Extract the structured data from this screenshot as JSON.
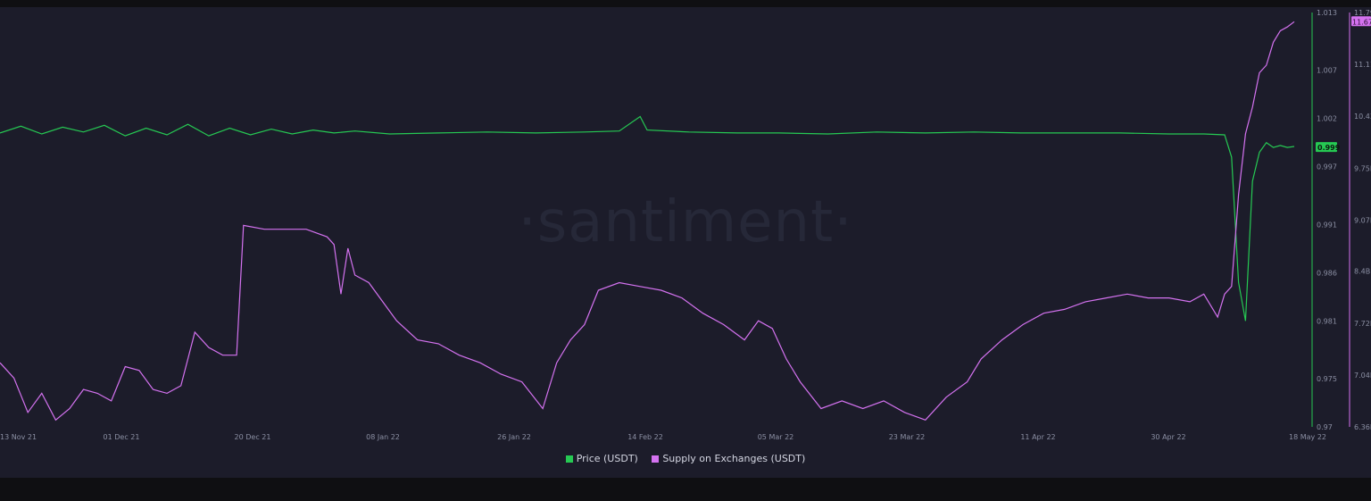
{
  "watermark": "·santiment·",
  "colors": {
    "background": "#1c1c2a",
    "price": "#26c953",
    "supply": "#d472f0",
    "text": "#8b8fa3"
  },
  "chart_data": {
    "type": "line",
    "x_ticks": [
      "13 Nov 21",
      "01 Dec 21",
      "20 Dec 21",
      "08 Jan 22",
      "26 Jan 22",
      "14 Feb 22",
      "05 Mar 22",
      "23 Mar 22",
      "11 Apr 22",
      "30 Apr 22",
      "18 May 22"
    ],
    "x_range": [
      "2021-11-13",
      "2022-05-18"
    ],
    "y_left": {
      "ticks": [
        "1.013",
        "1.007",
        "1.002",
        "0.997",
        "0.991",
        "0.986",
        "0.981",
        "0.975",
        "0.97"
      ],
      "range": [
        0.97,
        1.013
      ]
    },
    "y_right": {
      "ticks": [
        "11.79B",
        "11.11B",
        "10.43B",
        "9.75B",
        "9.07B",
        "8.4B",
        "7.72B",
        "7.04B",
        "6.36B"
      ],
      "range": [
        6.36,
        11.79
      ]
    },
    "current_labels": {
      "price": "0.999",
      "supply": "11.67B"
    },
    "legend": [
      {
        "name": "Price (USDT)",
        "color": "#26c953"
      },
      {
        "name": "Supply on Exchanges (USDT)",
        "color": "#d472f0"
      }
    ],
    "series": [
      {
        "name": "Price (USDT)",
        "axis": "left",
        "points": [
          [
            "2021-11-13",
            1.0005
          ],
          [
            "2021-11-16",
            1.0012
          ],
          [
            "2021-11-19",
            1.0004
          ],
          [
            "2021-11-22",
            1.0011
          ],
          [
            "2021-11-25",
            1.0006
          ],
          [
            "2021-11-28",
            1.0013
          ],
          [
            "2021-12-01",
            1.0002
          ],
          [
            "2021-12-04",
            1.001
          ],
          [
            "2021-12-07",
            1.0003
          ],
          [
            "2021-12-10",
            1.0014
          ],
          [
            "2021-12-13",
            1.0002
          ],
          [
            "2021-12-16",
            1.001
          ],
          [
            "2021-12-19",
            1.0003
          ],
          [
            "2021-12-22",
            1.0009
          ],
          [
            "2021-12-25",
            1.0004
          ],
          [
            "2021-12-28",
            1.0008
          ],
          [
            "2021-12-31",
            1.0005
          ],
          [
            "2022-01-03",
            1.0007
          ],
          [
            "2022-01-08",
            1.0004
          ],
          [
            "2022-01-15",
            1.0005
          ],
          [
            "2022-01-22",
            1.0006
          ],
          [
            "2022-01-29",
            1.0005
          ],
          [
            "2022-02-05",
            1.0006
          ],
          [
            "2022-02-10",
            1.0007
          ],
          [
            "2022-02-13",
            1.0022
          ],
          [
            "2022-02-14",
            1.0008
          ],
          [
            "2022-02-20",
            1.0006
          ],
          [
            "2022-02-27",
            1.0005
          ],
          [
            "2022-03-05",
            1.0005
          ],
          [
            "2022-03-12",
            1.0004
          ],
          [
            "2022-03-19",
            1.0006
          ],
          [
            "2022-03-26",
            1.0005
          ],
          [
            "2022-04-02",
            1.0006
          ],
          [
            "2022-04-09",
            1.0005
          ],
          [
            "2022-04-16",
            1.0005
          ],
          [
            "2022-04-23",
            1.0005
          ],
          [
            "2022-04-30",
            1.0004
          ],
          [
            "2022-05-05",
            1.0004
          ],
          [
            "2022-05-08",
            1.0003
          ],
          [
            "2022-05-09",
            0.998
          ],
          [
            "2022-05-10",
            0.985
          ],
          [
            "2022-05-11",
            0.981
          ],
          [
            "2022-05-12",
            0.9955
          ],
          [
            "2022-05-13",
            0.9985
          ],
          [
            "2022-05-14",
            0.9995
          ],
          [
            "2022-05-15",
            0.999
          ],
          [
            "2022-05-16",
            0.9992
          ],
          [
            "2022-05-17",
            0.999
          ],
          [
            "2022-05-18",
            0.9991
          ]
        ]
      },
      {
        "name": "Supply on Exchanges (USDT)",
        "axis": "right",
        "points": [
          [
            "2021-11-13",
            7.2
          ],
          [
            "2021-11-15",
            7.0
          ],
          [
            "2021-11-17",
            6.55
          ],
          [
            "2021-11-19",
            6.8
          ],
          [
            "2021-11-21",
            6.45
          ],
          [
            "2021-11-23",
            6.6
          ],
          [
            "2021-11-25",
            6.85
          ],
          [
            "2021-11-27",
            6.8
          ],
          [
            "2021-11-29",
            6.7
          ],
          [
            "2021-12-01",
            7.15
          ],
          [
            "2021-12-03",
            7.1
          ],
          [
            "2021-12-05",
            6.85
          ],
          [
            "2021-12-07",
            6.8
          ],
          [
            "2021-12-09",
            6.9
          ],
          [
            "2021-12-11",
            7.6
          ],
          [
            "2021-12-13",
            7.4
          ],
          [
            "2021-12-15",
            7.3
          ],
          [
            "2021-12-17",
            7.3
          ],
          [
            "2021-12-18",
            9.0
          ],
          [
            "2021-12-21",
            8.95
          ],
          [
            "2021-12-24",
            8.95
          ],
          [
            "2021-12-27",
            8.95
          ],
          [
            "2021-12-30",
            8.85
          ],
          [
            "2021-12-31",
            8.75
          ],
          [
            "2022-01-01",
            8.1
          ],
          [
            "2022-01-02",
            8.7
          ],
          [
            "2022-01-03",
            8.35
          ],
          [
            "2022-01-05",
            8.25
          ],
          [
            "2022-01-07",
            8.0
          ],
          [
            "2022-01-09",
            7.75
          ],
          [
            "2022-01-12",
            7.5
          ],
          [
            "2022-01-15",
            7.45
          ],
          [
            "2022-01-18",
            7.3
          ],
          [
            "2022-01-21",
            7.2
          ],
          [
            "2022-01-24",
            7.05
          ],
          [
            "2022-01-27",
            6.95
          ],
          [
            "2022-01-30",
            6.6
          ],
          [
            "2022-02-01",
            7.2
          ],
          [
            "2022-02-03",
            7.5
          ],
          [
            "2022-02-05",
            7.7
          ],
          [
            "2022-02-07",
            8.15
          ],
          [
            "2022-02-10",
            8.25
          ],
          [
            "2022-02-13",
            8.2
          ],
          [
            "2022-02-16",
            8.15
          ],
          [
            "2022-02-19",
            8.05
          ],
          [
            "2022-02-22",
            7.85
          ],
          [
            "2022-02-25",
            7.7
          ],
          [
            "2022-02-28",
            7.5
          ],
          [
            "2022-03-02",
            7.75
          ],
          [
            "2022-03-04",
            7.65
          ],
          [
            "2022-03-06",
            7.25
          ],
          [
            "2022-03-08",
            6.95
          ],
          [
            "2022-03-11",
            6.6
          ],
          [
            "2022-03-14",
            6.7
          ],
          [
            "2022-03-17",
            6.6
          ],
          [
            "2022-03-20",
            6.7
          ],
          [
            "2022-03-23",
            6.55
          ],
          [
            "2022-03-26",
            6.45
          ],
          [
            "2022-03-29",
            6.75
          ],
          [
            "2022-04-01",
            6.95
          ],
          [
            "2022-04-03",
            7.25
          ],
          [
            "2022-04-06",
            7.5
          ],
          [
            "2022-04-09",
            7.7
          ],
          [
            "2022-04-12",
            7.85
          ],
          [
            "2022-04-15",
            7.9
          ],
          [
            "2022-04-18",
            8.0
          ],
          [
            "2022-04-21",
            8.05
          ],
          [
            "2022-04-24",
            8.1
          ],
          [
            "2022-04-27",
            8.05
          ],
          [
            "2022-04-30",
            8.05
          ],
          [
            "2022-05-03",
            8.0
          ],
          [
            "2022-05-05",
            8.1
          ],
          [
            "2022-05-07",
            7.8
          ],
          [
            "2022-05-08",
            8.1
          ],
          [
            "2022-05-09",
            8.2
          ],
          [
            "2022-05-10",
            9.4
          ],
          [
            "2022-05-11",
            10.2
          ],
          [
            "2022-05-12",
            10.55
          ],
          [
            "2022-05-13",
            11.0
          ],
          [
            "2022-05-14",
            11.1
          ],
          [
            "2022-05-15",
            11.4
          ],
          [
            "2022-05-16",
            11.55
          ],
          [
            "2022-05-17",
            11.6
          ],
          [
            "2022-05-18",
            11.67
          ]
        ]
      }
    ]
  }
}
